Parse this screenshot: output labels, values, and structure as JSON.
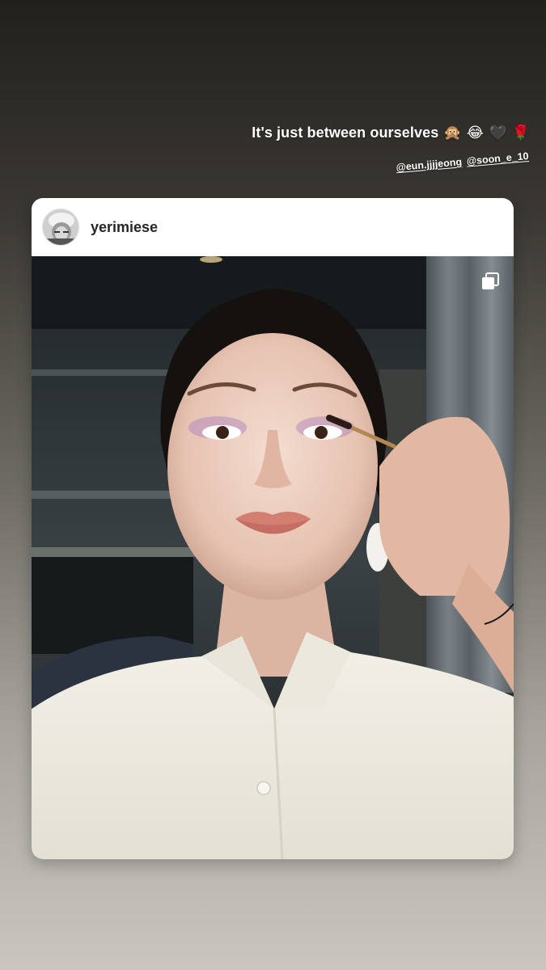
{
  "story": {
    "caption_text": "It's just between ourselves",
    "caption_emojis": [
      "🙊",
      "😂",
      "🖤",
      "🌹"
    ],
    "mentions": [
      "@eun.jjjjeong",
      "@soon_e_10"
    ]
  },
  "post": {
    "username": "yerimiese",
    "avatar_icon": "profile-avatar",
    "multi_image_icon": "carousel-icon"
  },
  "colors": {
    "card_background": "#ffffff",
    "username_color": "#262626",
    "caption_color": "#ffffff"
  }
}
